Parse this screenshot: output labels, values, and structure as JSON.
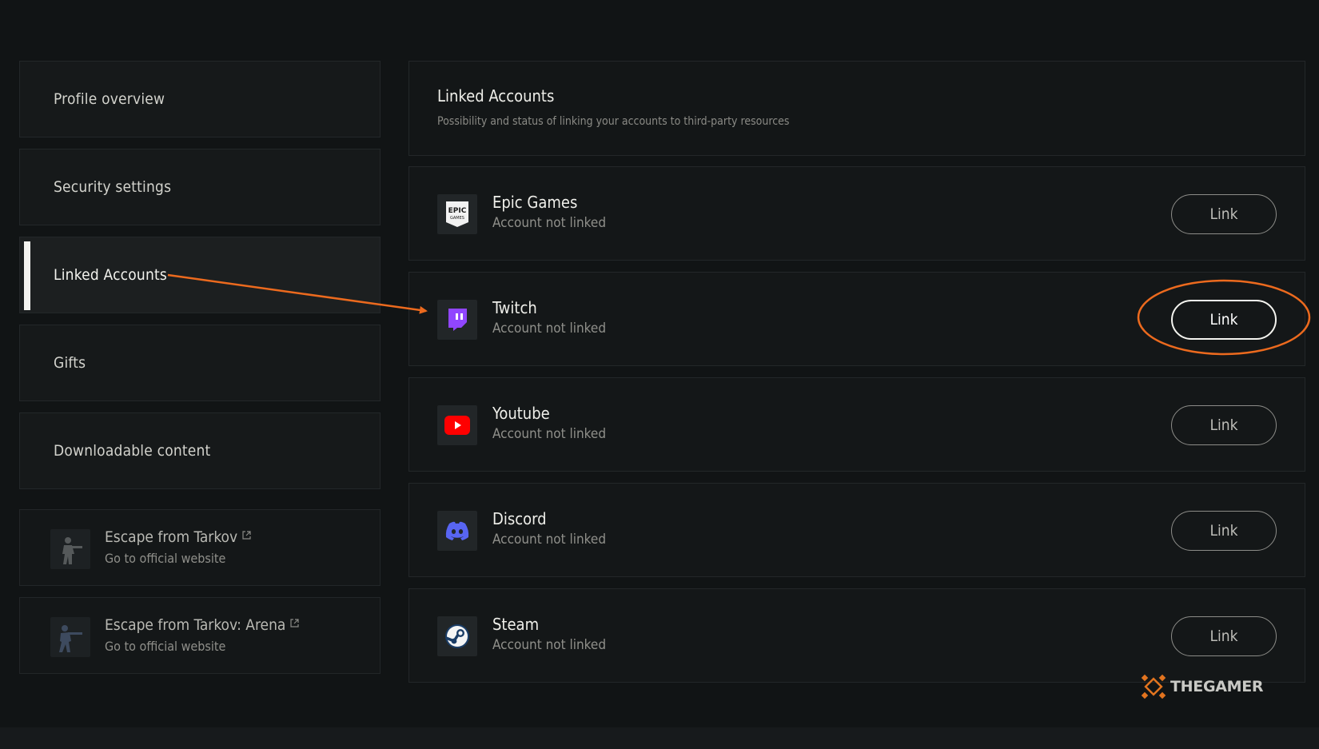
{
  "sidebar": {
    "items": [
      {
        "label": "Profile overview"
      },
      {
        "label": "Security settings"
      },
      {
        "label": "Linked Accounts",
        "active": true
      },
      {
        "label": "Gifts"
      },
      {
        "label": "Downloadable content"
      }
    ],
    "external": [
      {
        "title": "Escape from Tarkov",
        "subtitle": "Go to official website",
        "icon": "soldier-icon"
      },
      {
        "title": "Escape from Tarkov: Arena",
        "subtitle": "Go to official website",
        "icon": "soldier-aiming-icon"
      }
    ]
  },
  "main": {
    "title": "Linked Accounts",
    "subtitle": "Possibility and status of linking your accounts to third-party resources",
    "accounts": [
      {
        "name": "Epic Games",
        "status": "Account not linked",
        "button": "Link",
        "icon": "epic-games-icon"
      },
      {
        "name": "Twitch",
        "status": "Account not linked",
        "button": "Link",
        "icon": "twitch-icon",
        "highlighted": true
      },
      {
        "name": "Youtube",
        "status": "Account not linked",
        "button": "Link",
        "icon": "youtube-icon"
      },
      {
        "name": "Discord",
        "status": "Account not linked",
        "button": "Link",
        "icon": "discord-icon"
      },
      {
        "name": "Steam",
        "status": "Account not linked",
        "button": "Link",
        "icon": "steam-icon"
      }
    ]
  },
  "watermark": {
    "text": "THEGAMER"
  },
  "colors": {
    "background": "#111415",
    "panel": "#16191a",
    "annotation": "#ec6a1e",
    "twitch": "#9146ff",
    "youtube": "#ff0000",
    "discord": "#5865f2"
  }
}
